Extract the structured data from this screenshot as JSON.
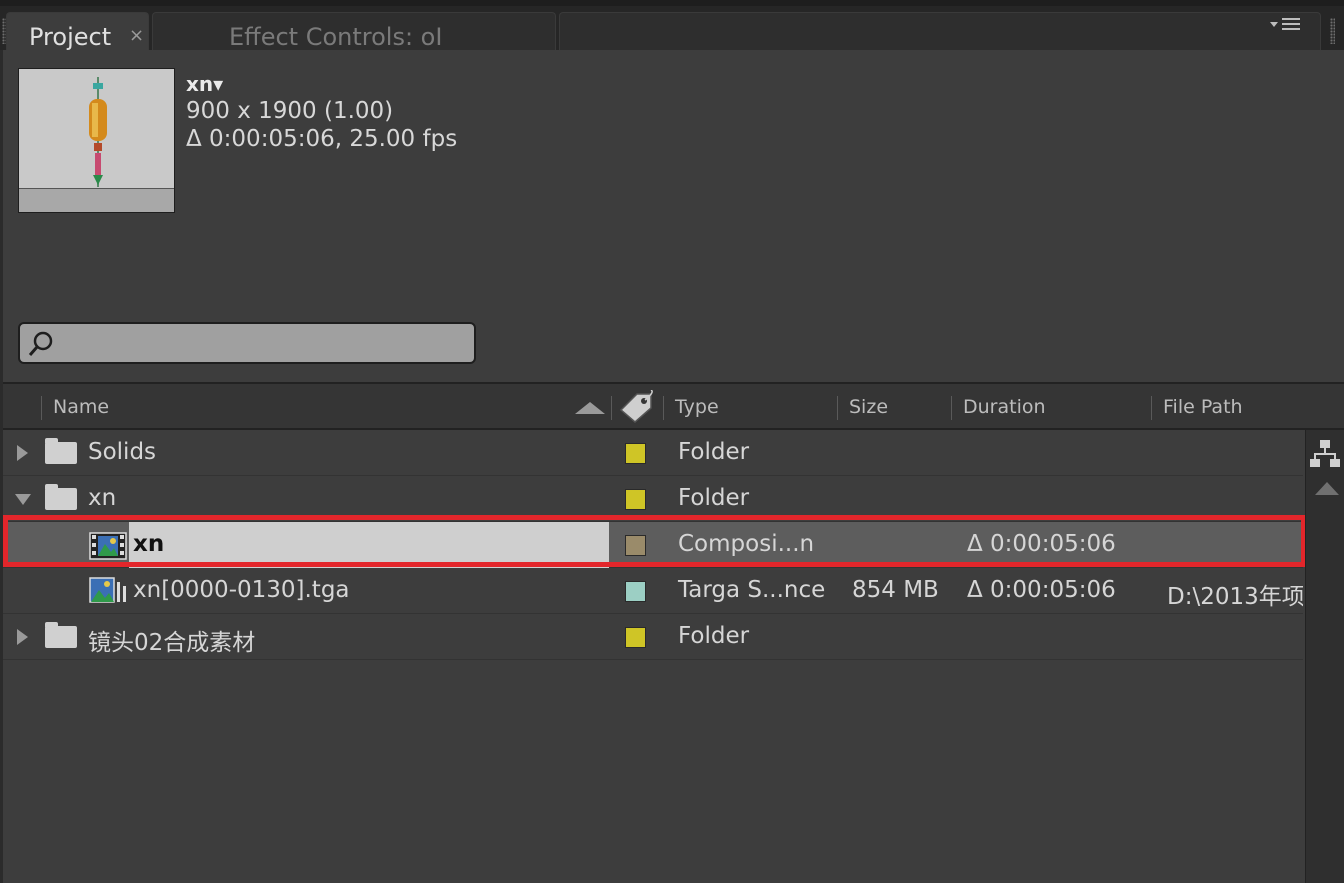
{
  "tabs": {
    "project": {
      "label": "Project",
      "close": "×"
    },
    "effect_controls": {
      "label": "Effect Controls: oI"
    },
    "menu_icon": "panel-menu-icon"
  },
  "preview": {
    "name": "xn▾",
    "dimensions": "900 x 1900 (1.00)",
    "duration_fps": "Δ 0:00:05:06, 25.00 fps"
  },
  "search": {
    "placeholder": "",
    "icon": "search-icon"
  },
  "columns": {
    "name": "Name",
    "type": "Type",
    "size": "Size",
    "duration": "Duration",
    "file_path": "File Path"
  },
  "rows": [
    {
      "name": "Solids",
      "kind": "folder",
      "expanded": false,
      "label_color": "#cfc526",
      "type": "Folder",
      "size": "",
      "duration": "",
      "file_path": ""
    },
    {
      "name": "xn",
      "kind": "folder",
      "expanded": true,
      "label_color": "#cfc526",
      "type": "Folder",
      "size": "",
      "duration": "",
      "file_path": ""
    },
    {
      "name": "xn",
      "kind": "composition",
      "selected": true,
      "label_color": "#9a8b6a",
      "type": "Composi...n",
      "size": "",
      "duration": "Δ 0:00:05:06",
      "file_path": ""
    },
    {
      "name": "xn[0000-0130].tga",
      "kind": "footage",
      "label_color": "#9ccfc4",
      "type": "Targa S...nce",
      "size": "854 MB",
      "duration": "Δ 0:00:05:06",
      "file_path": "D:\\2013年项"
    },
    {
      "name": "镜头02合成素材",
      "kind": "folder",
      "expanded": false,
      "label_color": "#cfc526",
      "type": "Folder",
      "size": "",
      "duration": "",
      "file_path": ""
    }
  ],
  "colors": {
    "selection_outline": "#e3262b",
    "panel_bg": "#3d3d3d"
  }
}
